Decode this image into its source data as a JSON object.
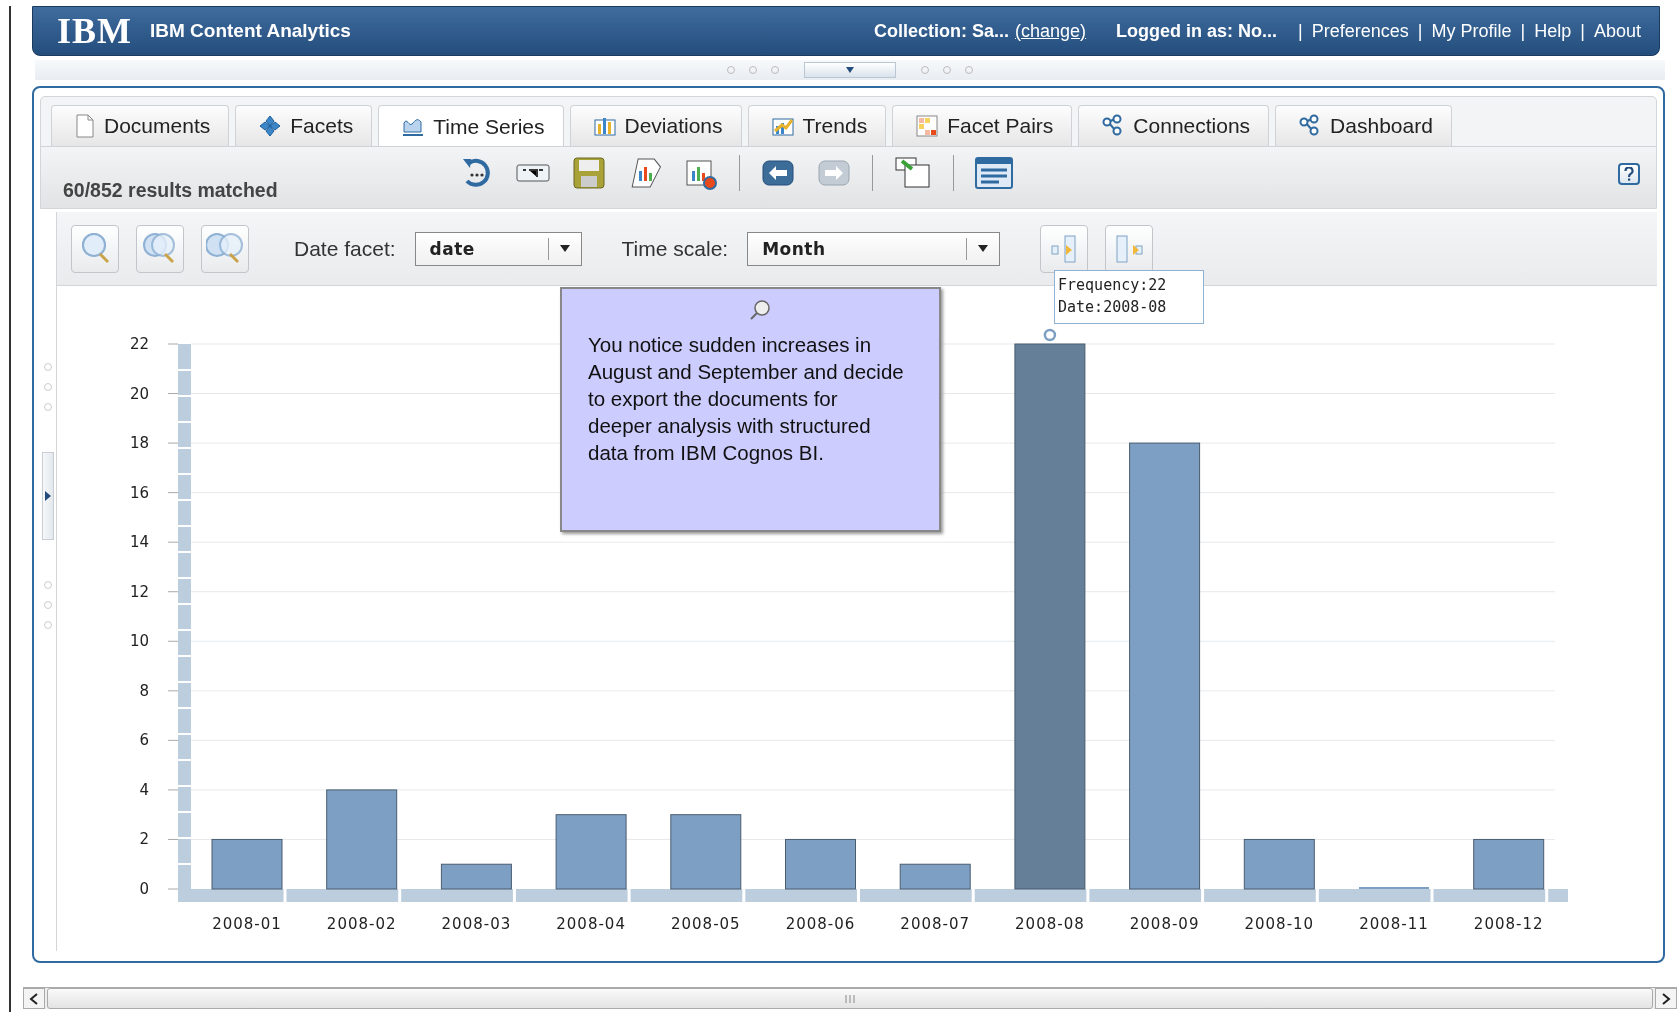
{
  "header": {
    "logo": "IBM",
    "title": "IBM Content Analytics",
    "collection": "Collection: Sa...",
    "change_link": "(change)",
    "user": "Logged in as: No...",
    "separator": "|",
    "links": [
      "Preferences",
      "My Profile",
      "Help",
      "About"
    ]
  },
  "tabs": [
    {
      "label": "Documents",
      "kind": "document",
      "selected": false
    },
    {
      "label": "Facets",
      "kind": "facets",
      "selected": false
    },
    {
      "label": "Time Series",
      "kind": "timeseries",
      "selected": true
    },
    {
      "label": "Deviations",
      "kind": "deviations",
      "selected": false
    },
    {
      "label": "Trends",
      "kind": "trends",
      "selected": false
    },
    {
      "label": "Facet Pairs",
      "kind": "pairs",
      "selected": false
    },
    {
      "label": "Connections",
      "kind": "connections",
      "selected": false
    },
    {
      "label": "Dashboard",
      "kind": "connections",
      "selected": false
    }
  ],
  "toolbar": {
    "results": "60/852 results matched"
  },
  "controls": {
    "date_facet": {
      "label": "Date facet:",
      "value": "date"
    },
    "time_scale": {
      "label": "Time scale:",
      "value": "Month"
    }
  },
  "chart": {
    "chart_data": {
      "type": "bar",
      "categories": [
        "2008-01",
        "2008-02",
        "2008-03",
        "2008-04",
        "2008-05",
        "2008-06",
        "2008-07",
        "2008-08",
        "2008-09",
        "2008-10",
        "2008-11",
        "2008-12"
      ],
      "series": [
        {
          "color": "#7d9fc3",
          "values": [
            2,
            4,
            1,
            3,
            3,
            2,
            1,
            null,
            18,
            2,
            0,
            2
          ]
        },
        {
          "color": "#647f97",
          "values": [
            null,
            null,
            null,
            null,
            null,
            null,
            null,
            22,
            null,
            null,
            null,
            null
          ]
        }
      ],
      "ylim": [
        0,
        22
      ],
      "yticks": [
        0,
        2,
        4,
        6,
        8,
        10,
        12,
        14,
        16,
        18,
        20,
        22
      ],
      "grid": true
    },
    "tooltip": [
      "Frequency:22",
      "Date:2008-08"
    ],
    "callout": "You notice sudden increases in August and September and decide to export the documents for deeper analysis with structured data from IBM Cognos BI."
  }
}
